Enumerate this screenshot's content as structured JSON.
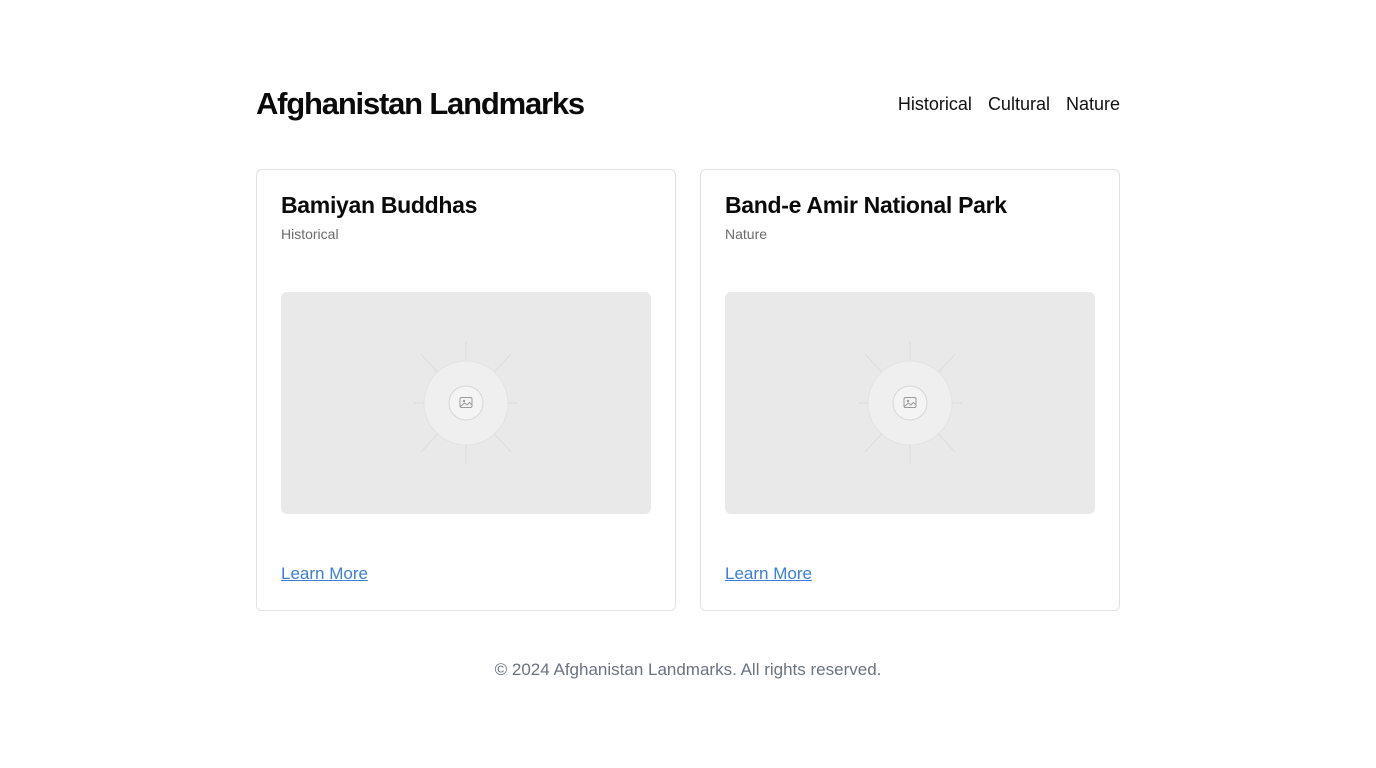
{
  "header": {
    "title": "Afghanistan Landmarks",
    "nav": [
      "Historical",
      "Cultural",
      "Nature"
    ]
  },
  "cards": [
    {
      "title": "Bamiyan Buddhas",
      "category": "Historical",
      "image_icon": "image-icon",
      "link_label": "Learn More"
    },
    {
      "title": "Band-e Amir National Park",
      "category": "Nature",
      "image_icon": "image-icon",
      "link_label": "Learn More"
    }
  ],
  "footer": {
    "text": "© 2024 Afghanistan Landmarks. All rights reserved."
  },
  "colors": {
    "link": "#3b7fd6",
    "placeholder_bg": "#e9e9e9",
    "muted_text": "#6b7280"
  }
}
